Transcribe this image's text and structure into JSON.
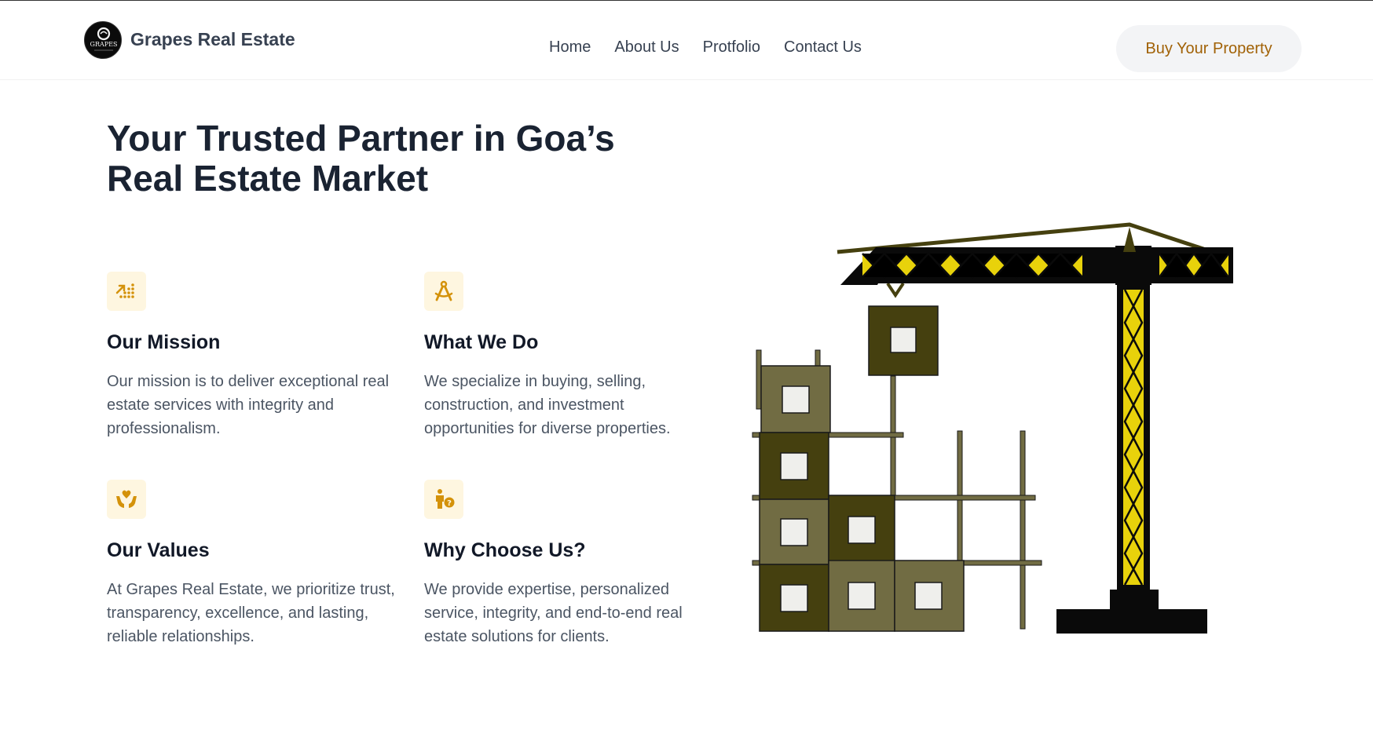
{
  "brand": {
    "name": "Grapes Real Estate",
    "logo_text": "GRAPES"
  },
  "nav": {
    "items": [
      "Home",
      "About Us",
      "Protfolio",
      "Contact Us"
    ]
  },
  "cta": {
    "label": "Buy Your Property"
  },
  "hero": {
    "title_line1": "Your Trusted Partner in Goa’s",
    "title_line2": "Real Estate Market"
  },
  "features": [
    {
      "icon": "growth-chart-icon",
      "title": "Our Mission",
      "text": "Our mission is to deliver exceptional real estate services with integrity and professionalism."
    },
    {
      "icon": "drafting-compass-icon",
      "title": "What We Do",
      "text": "We specialize in buying, selling, construction, and investment opportunities for diverse properties."
    },
    {
      "icon": "hands-heart-icon",
      "title": "Our Values",
      "text": "At Grapes Real Estate, we prioritize trust, transparency, excellence, and lasting, reliable relationships."
    },
    {
      "icon": "person-question-icon",
      "title": "Why Choose Us?",
      "text": "We provide expertise, personalized service, integrity, and end-to-end real estate solutions for clients."
    }
  ],
  "colors": {
    "accent": "#a16207",
    "icon_gold": "#d4920a",
    "crane_yellow": "#e8d20b",
    "block_dark": "#45400f",
    "block_light": "#716c43"
  }
}
